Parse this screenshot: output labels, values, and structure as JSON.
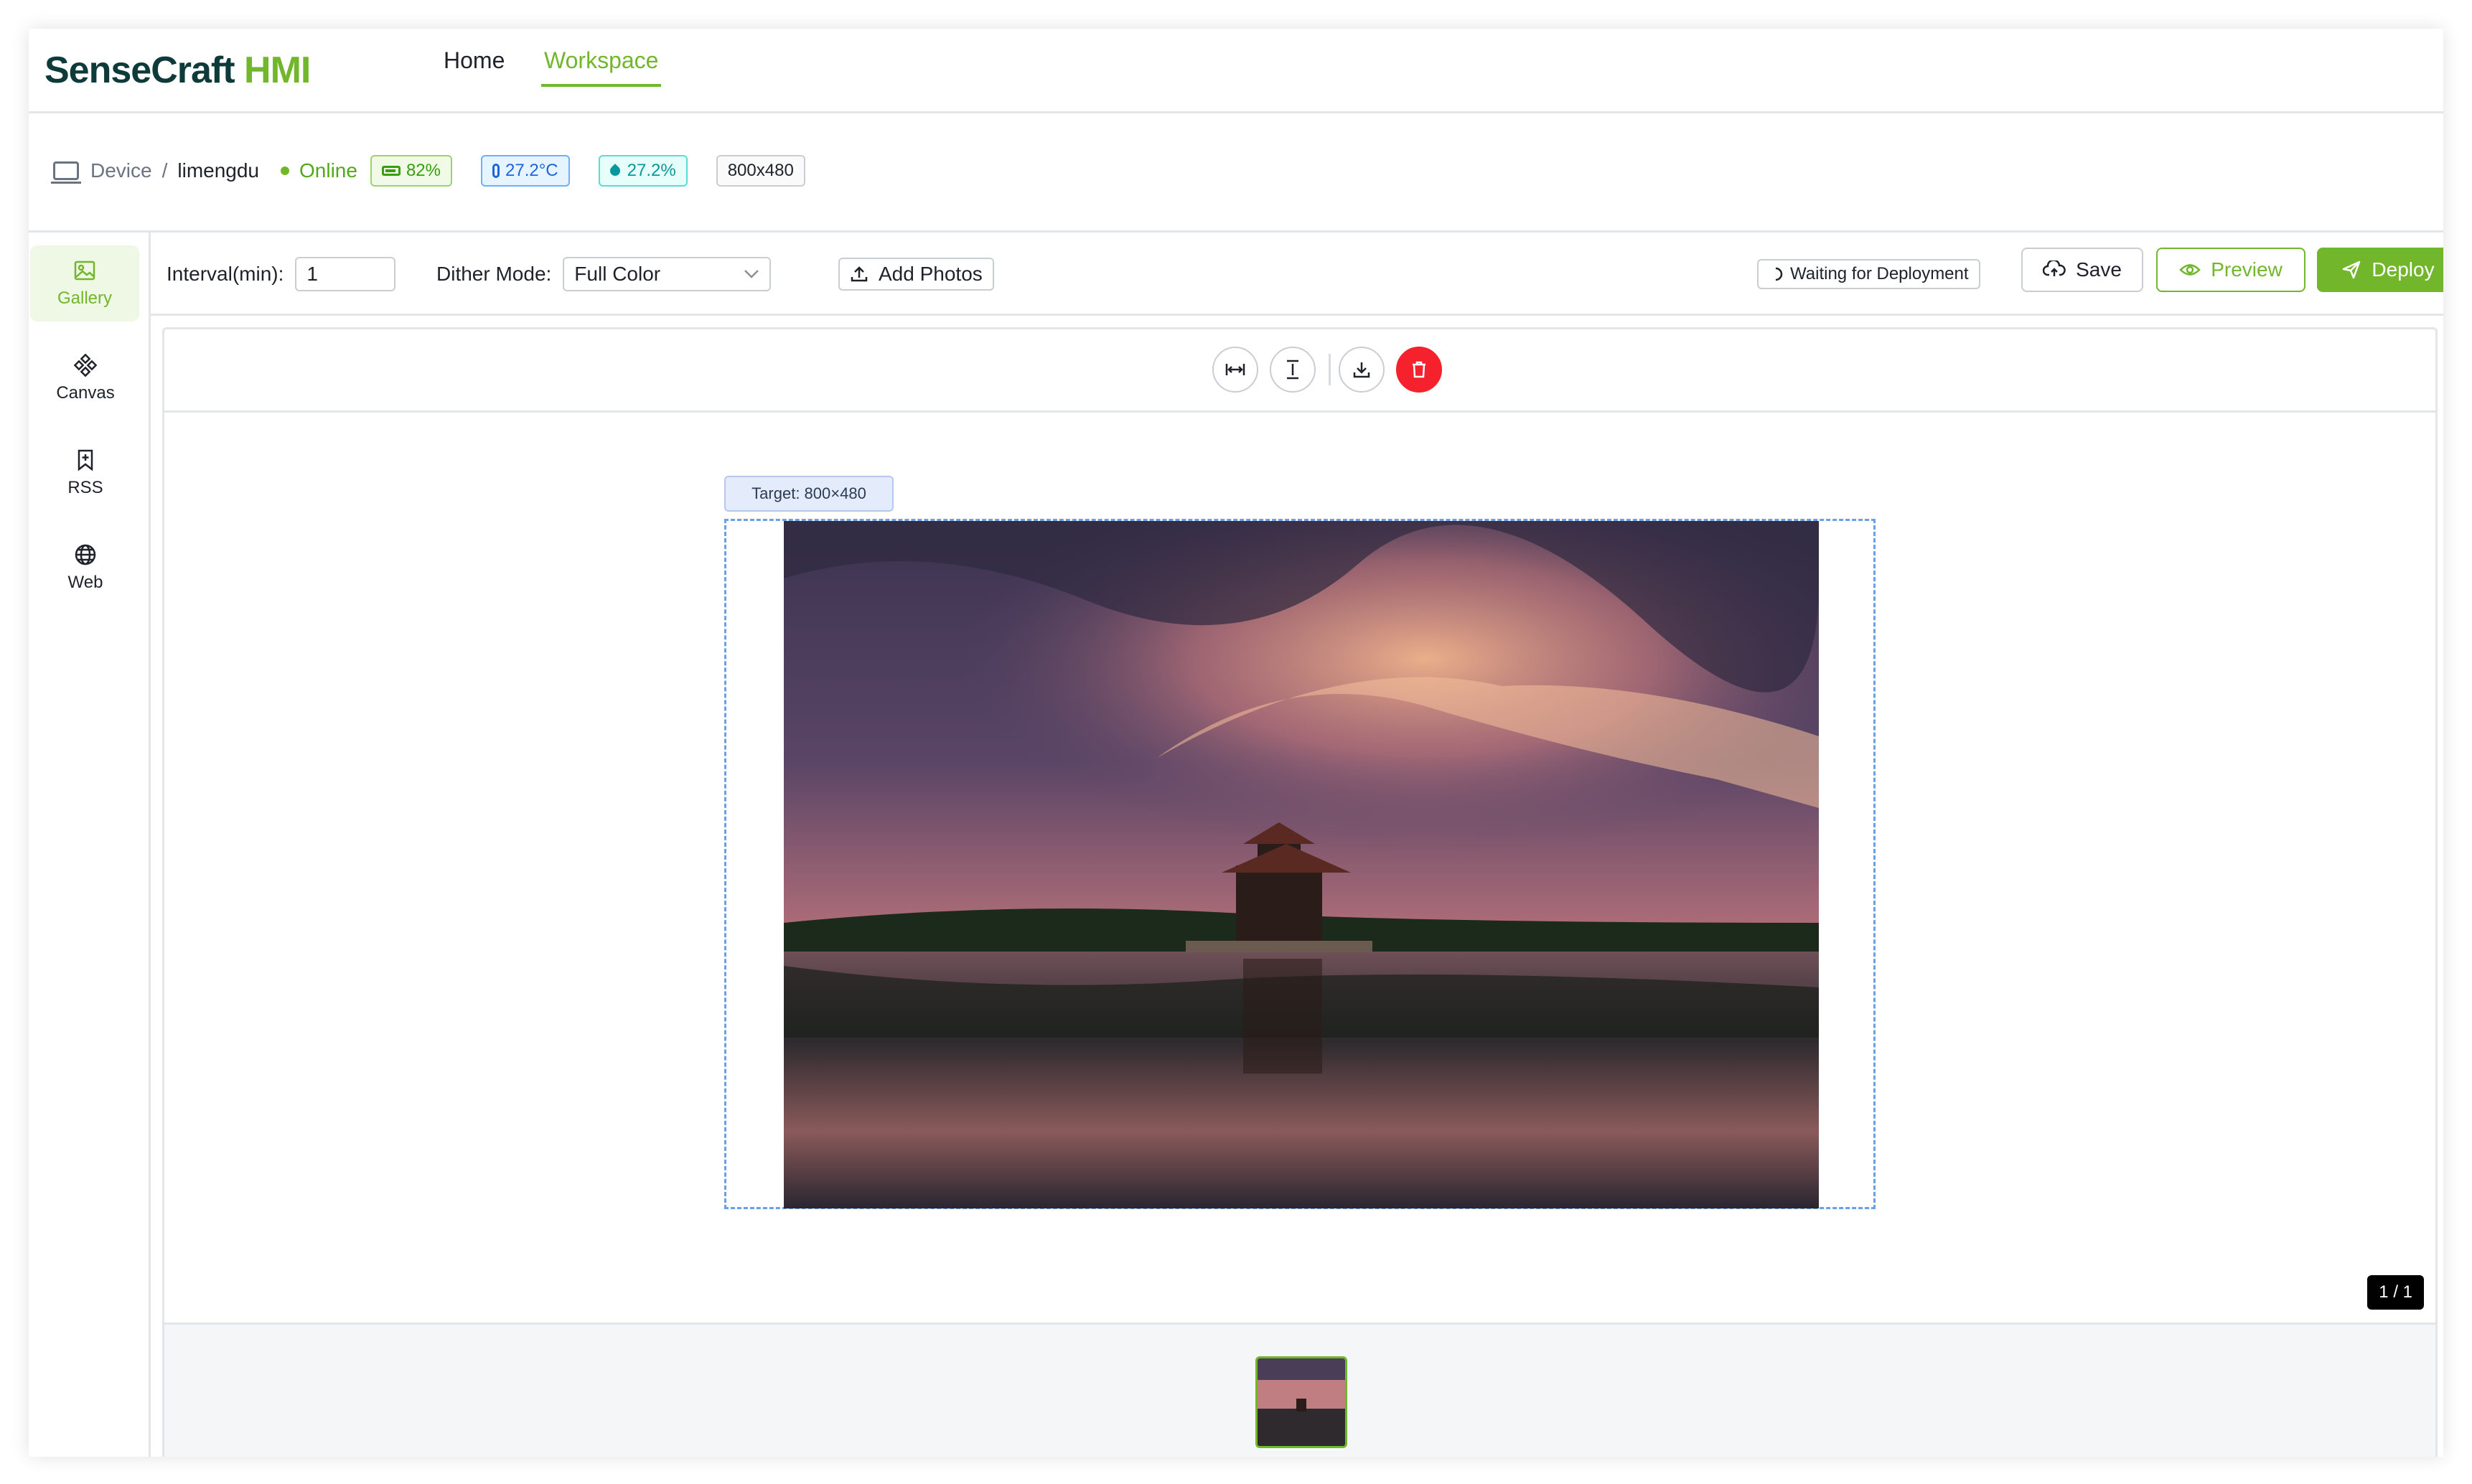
{
  "brand": {
    "name_part1": "SenseCraft",
    "name_part2": " HMI"
  },
  "nav": {
    "home": "Home",
    "workspace": "Workspace"
  },
  "device": {
    "breadcrumb_root": "Device",
    "separator": "/",
    "name": "limengdu",
    "status": "Online",
    "battery": "82%",
    "temperature": "27.2°C",
    "humidity": "27.2%",
    "resolution": "800x480"
  },
  "sidebar": {
    "items": [
      {
        "label": "Gallery",
        "icon": "image-icon"
      },
      {
        "label": "Canvas",
        "icon": "diamond-grid-icon"
      },
      {
        "label": "RSS",
        "icon": "bookmark-plus-icon"
      },
      {
        "label": "Web",
        "icon": "globe-icon"
      }
    ]
  },
  "toolbar": {
    "interval_label": "Interval(min):",
    "interval_value": "1",
    "dither_label": "Dither Mode:",
    "dither_value": "Full Color",
    "add_photos": "Add Photos",
    "status": "Waiting for Deployment",
    "save": "Save",
    "preview": "Preview",
    "deploy": "Deploy"
  },
  "editor": {
    "target_label": "Target: 800×480",
    "page_counter": "1 / 1"
  },
  "colors": {
    "accent": "#72b62b",
    "danger": "#f5222d",
    "brand_dark": "#0f3a3a"
  }
}
